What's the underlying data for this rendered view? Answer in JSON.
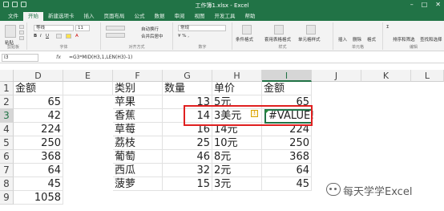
{
  "window": {
    "title": "工作簿1.xlsx - Excel"
  },
  "tabs": [
    "文件",
    "开始",
    "新建选项卡",
    "插入",
    "页面布局",
    "公式",
    "数据",
    "审阅",
    "视图",
    "开发工具",
    "帮助"
  ],
  "active_tab": "开始",
  "ribbon": {
    "paste_label": "粘贴",
    "font_name": "等线",
    "font_size": "11",
    "wrap_label": "自动换行",
    "merge_label": "合并后居中",
    "number_format": "常规",
    "cond_format_label": "条件格式",
    "table_format_label": "套用表格格式",
    "cell_style_label": "单元格样式",
    "insert_label": "插入",
    "delete_label": "删除",
    "format_label": "格式",
    "sort_filter_label": "排序和筛选",
    "find_select_label": "查找和选择",
    "groups": [
      "剪贴板",
      "字体",
      "对齐方式",
      "数字",
      "样式",
      "单元格",
      "编辑"
    ]
  },
  "formula_bar": {
    "name_box": "I3",
    "fx": "fx",
    "formula": "=G3*MID(H3,1,LEN(H3)-1)"
  },
  "columns": [
    "D",
    "E",
    "F",
    "G",
    "H",
    "I",
    "J",
    "K",
    "L"
  ],
  "selected_column": "I",
  "rows": [
    "1",
    "2",
    "3",
    "4",
    "5",
    "6",
    "7",
    "8",
    "9"
  ],
  "selected_row": "3",
  "cells": {
    "D1": "金额",
    "F1": "类别",
    "G1": "数量",
    "H1": "单价",
    "I1": "金额",
    "D2": "65",
    "F2": "苹果",
    "G2": "13",
    "H2": "5元",
    "I2": "65",
    "D3": "42",
    "F3": "香蕉",
    "G3": "14",
    "H3": "3美元",
    "I3": "#VALUE!",
    "D4": "224",
    "F4": "草莓",
    "G4": "16",
    "H4": "14元",
    "I4": "224",
    "D5": "250",
    "F5": "荔枝",
    "G5": "25",
    "H5": "10元",
    "I5": "250",
    "D6": "368",
    "F6": "葡萄",
    "G6": "46",
    "H6": "8元",
    "I6": "368",
    "D7": "64",
    "F7": "西瓜",
    "G7": "32",
    "H7": "2元",
    "I7": "64",
    "D8": "45",
    "F8": "菠萝",
    "G8": "15",
    "H8": "3元",
    "I8": "45",
    "D9": "1058"
  },
  "watermark": "每天学学Excel",
  "colors": {
    "excel_green": "#217346",
    "highlight_red": "#e02020"
  }
}
